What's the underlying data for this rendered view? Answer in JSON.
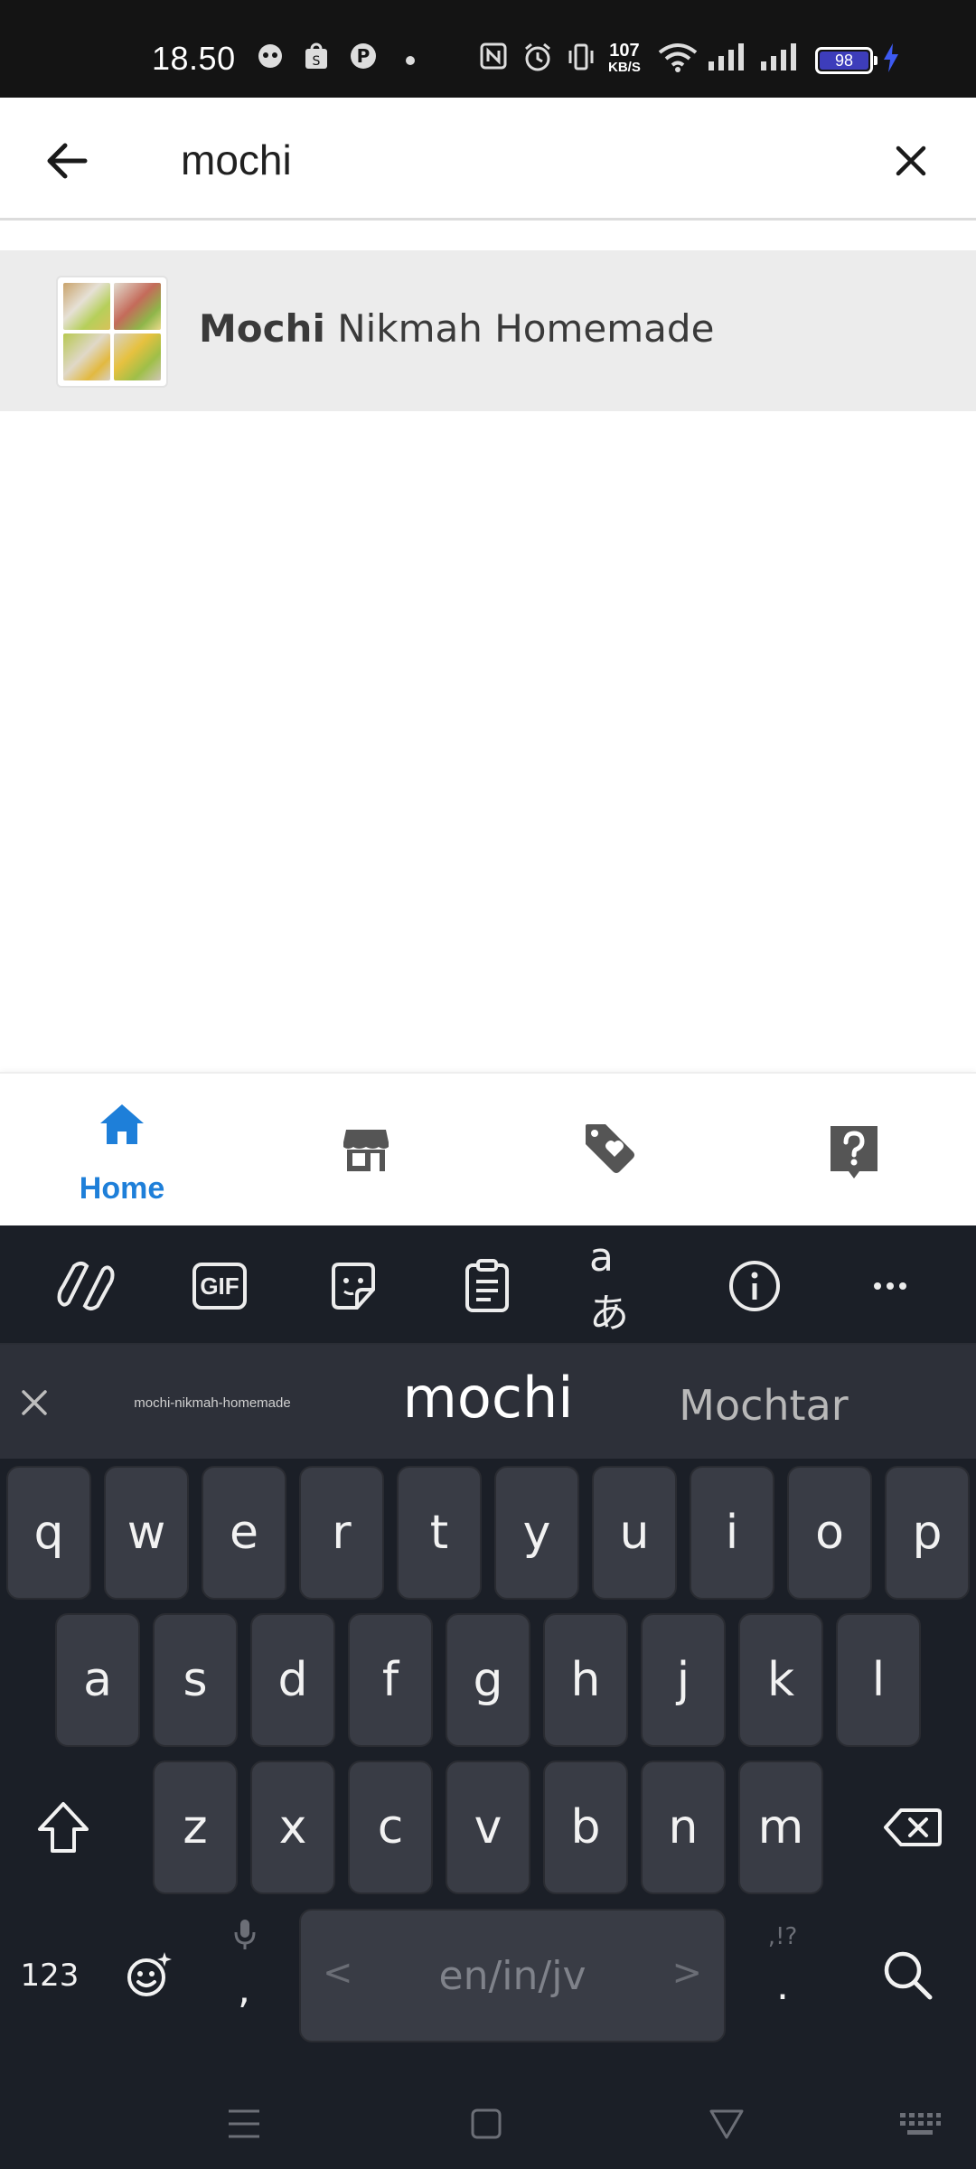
{
  "status_bar": {
    "time": "18.50",
    "net_speed_value": "107",
    "net_speed_unit": "KB/S",
    "battery_level": "98",
    "icons": [
      "notification-icon",
      "shopping-bag-icon",
      "pinterest-icon",
      "dot-icon",
      "nfc-icon",
      "alarm-icon",
      "vibrate-icon",
      "wifi-icon",
      "signal-icon",
      "signal-icon",
      "battery-icon",
      "charging-icon"
    ]
  },
  "search": {
    "value": "mochi",
    "placeholder": ""
  },
  "results": [
    {
      "match": "Mochi",
      "rest": " Nikmah Homemade"
    }
  ],
  "bottom_nav": {
    "items": [
      {
        "icon": "home-icon",
        "label": "Home",
        "active": true
      },
      {
        "icon": "store-icon",
        "label": "",
        "active": false
      },
      {
        "icon": "tag-heart-icon",
        "label": "",
        "active": false
      },
      {
        "icon": "help-icon",
        "label": "",
        "active": false
      }
    ]
  },
  "keyboard": {
    "toolbar": [
      "copilot-icon",
      "gif-icon",
      "sticker-icon",
      "clipboard-icon",
      "translate-icon",
      "info-icon",
      "more-icon"
    ],
    "gif_label": "GIF",
    "translate_label": "aあ",
    "suggestions": [
      "mochi-nikmah-homemade",
      "mochi",
      "Mochtar"
    ],
    "rows": [
      [
        "q",
        "w",
        "e",
        "r",
        "t",
        "y",
        "u",
        "i",
        "o",
        "p"
      ],
      [
        "a",
        "s",
        "d",
        "f",
        "g",
        "h",
        "j",
        "k",
        "l"
      ],
      [
        "z",
        "x",
        "c",
        "v",
        "b",
        "n",
        "m"
      ]
    ],
    "numbers_label": "123",
    "comma_label": ",",
    "space_label": "en/in/jv",
    "punct_hint": ",!?",
    "period_label": "."
  },
  "colors": {
    "accent": "#1e7fd9",
    "keyboard_bg": "#1b1f27",
    "key_bg": "#393c45"
  }
}
